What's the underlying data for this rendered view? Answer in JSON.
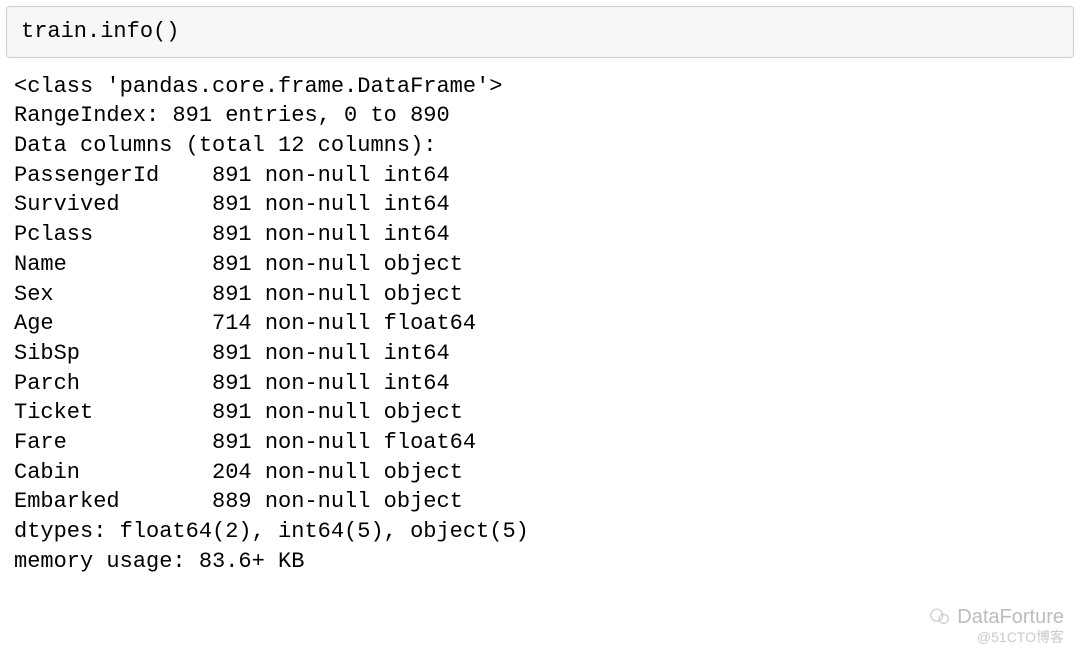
{
  "input": {
    "code": "train.info()"
  },
  "output": {
    "class_line": "<class 'pandas.core.frame.DataFrame'>",
    "range_index": "RangeIndex: 891 entries, 0 to 890",
    "data_columns_header": "Data columns (total 12 columns):",
    "columns": [
      {
        "name": "PassengerId",
        "count": "891",
        "dtype": "int64"
      },
      {
        "name": "Survived",
        "count": "891",
        "dtype": "int64"
      },
      {
        "name": "Pclass",
        "count": "891",
        "dtype": "int64"
      },
      {
        "name": "Name",
        "count": "891",
        "dtype": "object"
      },
      {
        "name": "Sex",
        "count": "891",
        "dtype": "object"
      },
      {
        "name": "Age",
        "count": "714",
        "dtype": "float64"
      },
      {
        "name": "SibSp",
        "count": "891",
        "dtype": "int64"
      },
      {
        "name": "Parch",
        "count": "891",
        "dtype": "int64"
      },
      {
        "name": "Ticket",
        "count": "891",
        "dtype": "object"
      },
      {
        "name": "Fare",
        "count": "891",
        "dtype": "float64"
      },
      {
        "name": "Cabin",
        "count": "204",
        "dtype": "object"
      },
      {
        "name": "Embarked",
        "count": "889",
        "dtype": "object"
      }
    ],
    "name_col_width": 15,
    "non_null_label": "non-null",
    "dtypes_line": "dtypes: float64(2), int64(5), object(5)",
    "memory_usage_line": "memory usage: 83.6+ KB"
  },
  "branding": {
    "main": "DataForture",
    "sub": "@51CTO博客"
  }
}
